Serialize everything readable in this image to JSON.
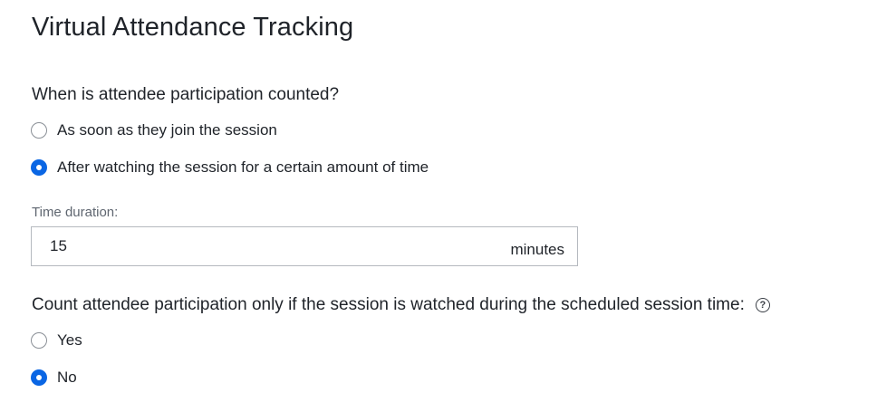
{
  "title": "Virtual Attendance Tracking",
  "question1": {
    "label": "When is attendee participation counted?",
    "options": [
      {
        "label": "As soon as they join the session",
        "selected": false
      },
      {
        "label": "After watching the session for a certain amount of time",
        "selected": true
      }
    ]
  },
  "duration": {
    "label": "Time duration:",
    "value": "15",
    "unit": "minutes"
  },
  "question2": {
    "label": "Count attendee participation only if the session is watched during the scheduled session time:",
    "help_icon": "question-circle-icon",
    "options": [
      {
        "label": "Yes",
        "selected": false
      },
      {
        "label": "No",
        "selected": true
      }
    ]
  },
  "colors": {
    "accent": "#0a66e4",
    "text": "#1f2329",
    "muted": "#5f6670"
  }
}
